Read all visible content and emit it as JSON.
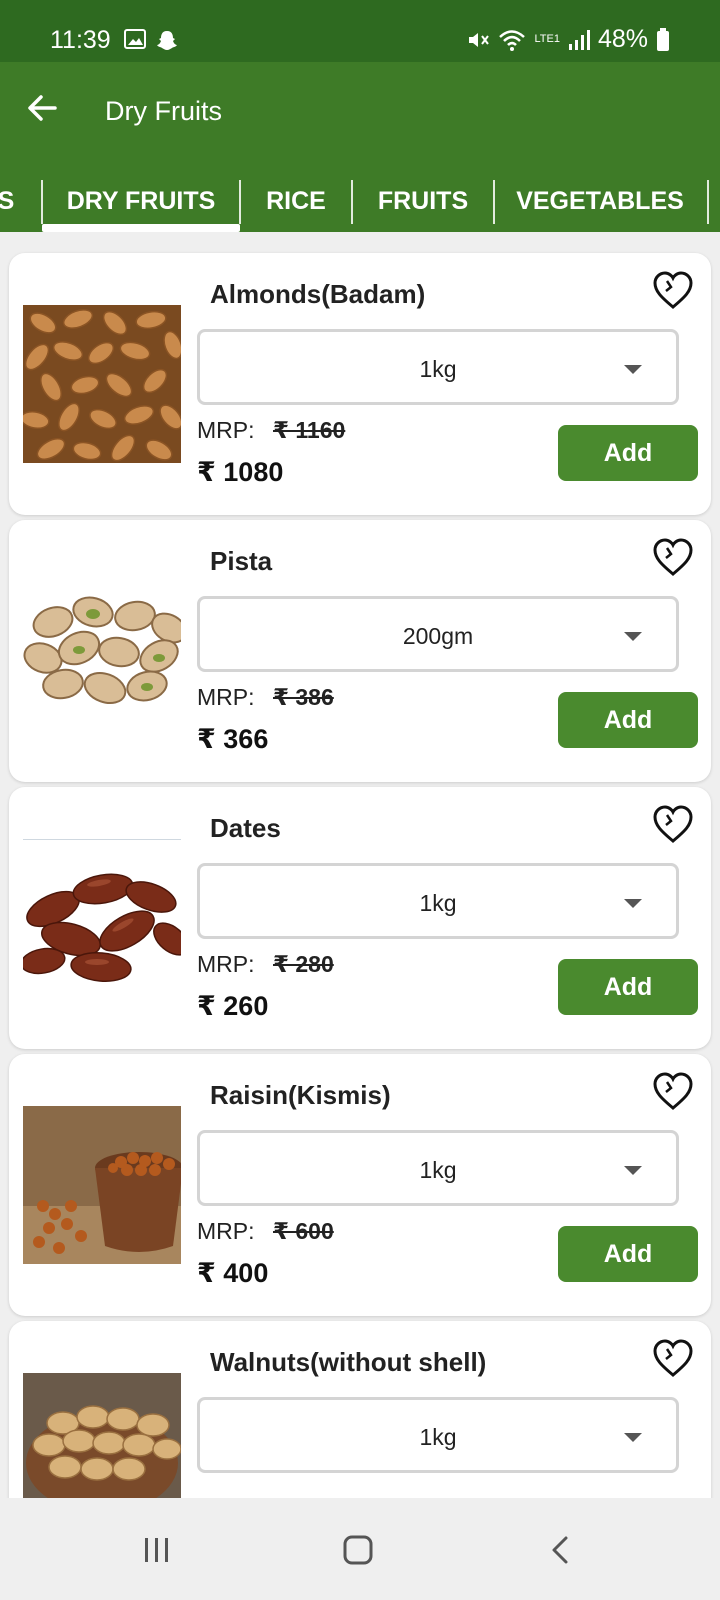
{
  "status": {
    "time": "11:39",
    "battery": "48%",
    "network": "LTE1",
    "left_icons": [
      "image-icon",
      "snapchat-icon"
    ],
    "right_icons": [
      "mute-icon",
      "wifi-icon",
      "signal-icon",
      "battery-icon"
    ]
  },
  "header": {
    "title": "Dry Fruits",
    "back_icon": "arrow-left-icon"
  },
  "tabs": [
    {
      "label": "S"
    },
    {
      "label": "DRY FRUITS",
      "selected": true
    },
    {
      "label": "RICE"
    },
    {
      "label": "FRUITS"
    },
    {
      "label": "VEGETABLES"
    }
  ],
  "products": [
    {
      "name": "Almonds(Badam)",
      "qty": "1kg",
      "mrp_label": "MRP:",
      "mrp": "₹ 1160",
      "price": "₹ 1080",
      "add_label": "Add",
      "image": "almonds"
    },
    {
      "name": "Pista",
      "qty": "200gm",
      "mrp_label": "MRP:",
      "mrp": "₹ 386",
      "price": "₹ 366",
      "add_label": "Add",
      "image": "pistachio"
    },
    {
      "name": "Dates",
      "qty": "1kg",
      "mrp_label": "MRP:",
      "mrp": "₹ 280",
      "price": "₹ 260",
      "add_label": "Add",
      "image": "dates"
    },
    {
      "name": "Raisin(Kismis)",
      "qty": "1kg",
      "mrp_label": "MRP:",
      "mrp": "₹ 600",
      "price": "₹ 400",
      "add_label": "Add",
      "image": "raisins"
    },
    {
      "name": "Walnuts(without shell)",
      "qty": "1kg",
      "image": "walnuts"
    }
  ],
  "nav": [
    "recents-icon",
    "home-icon",
    "back-icon"
  ],
  "colors": {
    "status_bar": "#2e6a20",
    "app_bar": "#3e7b27",
    "add_button": "#4a8a2e"
  }
}
